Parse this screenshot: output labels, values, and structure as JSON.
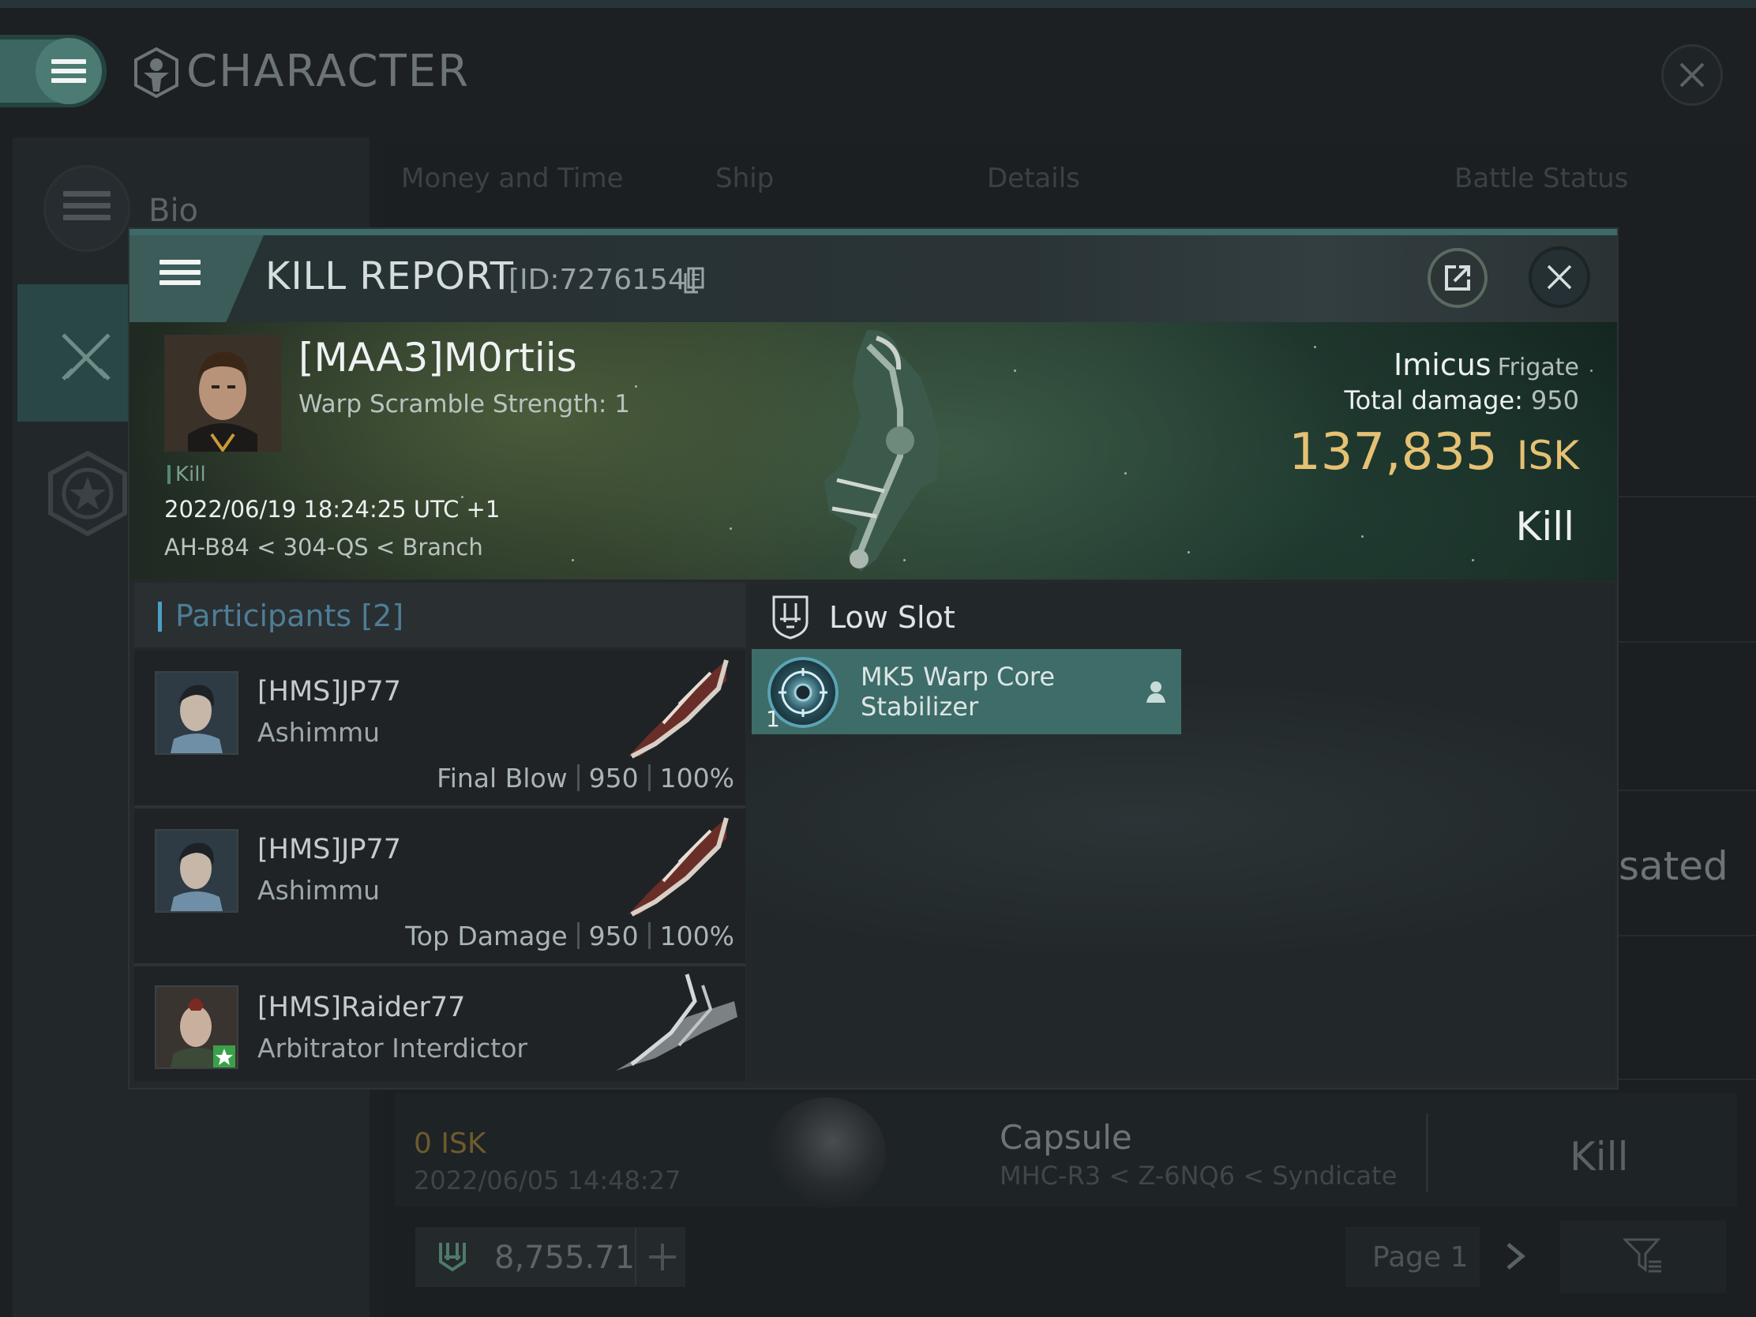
{
  "character_window": {
    "title": "CHARACTER",
    "side_tabs": [
      {
        "label": "Bio",
        "icon": "list-icon"
      },
      {
        "label": "",
        "icon": "crossed-swords-icon"
      },
      {
        "label": "",
        "icon": "star-badge-icon"
      }
    ],
    "tabs": [
      "Money and Time",
      "Ship",
      "Details",
      "Battle Status"
    ],
    "partial_text": "sated",
    "background_row": {
      "isk": "0 ISK",
      "date": "2022/06/05 14:48:27",
      "ship": "Capsule",
      "location": "MHC-R3 < Z-6NQ6 < Syndicate",
      "result": "Kill"
    },
    "wallet": {
      "amount": "8,755.71"
    },
    "pager": {
      "label": "Page 1"
    }
  },
  "kill_report": {
    "title": "KILL REPORT",
    "id_text": "[ID:7276154]",
    "victim": {
      "name": "[MAA3]M0rtiis",
      "warp_scramble": "Warp Scramble Strength: 1",
      "kill_tag": "Kill",
      "datetime": "2022/06/19 18:24:25 UTC +1",
      "location": "AH-B84 < 304-QS < Branch"
    },
    "ship": {
      "name": "Imicus",
      "class": "Frigate",
      "total_damage_label": "Total damage:",
      "total_damage": "950",
      "isk_value": "137,835",
      "isk_unit": "ISK",
      "result": "Kill"
    },
    "participants": {
      "label": "Participants",
      "count": "[2]",
      "rows": [
        {
          "name": "[HMS]JP77",
          "ship": "Ashimmu",
          "role": "Final Blow",
          "damage": "950",
          "percent": "100%"
        },
        {
          "name": "[HMS]JP77",
          "ship": "Ashimmu",
          "role": "Top Damage",
          "damage": "950",
          "percent": "100%"
        },
        {
          "name": "[HMS]Raider77",
          "ship": "Arbitrator Interdictor"
        }
      ]
    },
    "slots": {
      "section_label": "Low Slot",
      "items": [
        {
          "quantity": "1",
          "name": "MK5 Warp Core Stabilizer"
        }
      ]
    }
  },
  "colors": {
    "accent_teal": "#3c6b69",
    "isk_gold": "#e5c173",
    "participants_blue": "#4e7d96"
  }
}
